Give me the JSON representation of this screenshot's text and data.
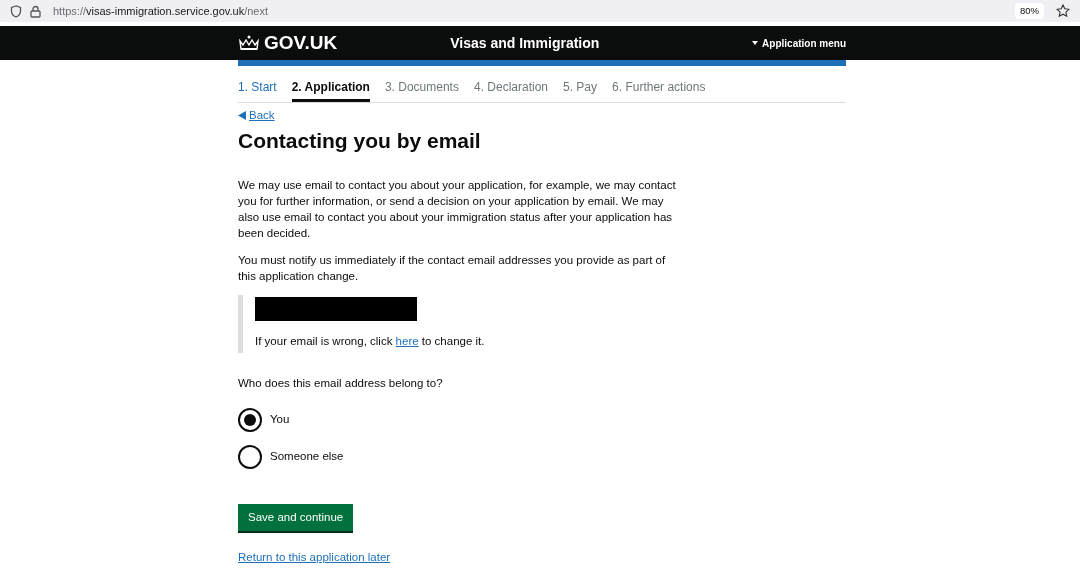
{
  "browser": {
    "url_scheme": "https://",
    "url_host": "visas-immigration.service.gov.uk",
    "url_path": "/next",
    "zoom": "80%"
  },
  "header": {
    "logo": "GOV.UK",
    "service": "Visas and Immigration",
    "menu": "Application menu"
  },
  "steps": [
    {
      "label": "1. Start",
      "completed": true,
      "selected": false
    },
    {
      "label": "2. Application",
      "completed": false,
      "selected": true
    },
    {
      "label": "3. Documents",
      "completed": false,
      "selected": false
    },
    {
      "label": "4. Declaration",
      "completed": false,
      "selected": false
    },
    {
      "label": "5. Pay",
      "completed": false,
      "selected": false
    },
    {
      "label": "6. Further actions",
      "completed": false,
      "selected": false
    }
  ],
  "back": "Back",
  "title": "Contacting you by email",
  "paragraphs": [
    "We may use email to contact you about your application, for example, we may contact you for further information, or send a decision on your application by email. We may also use email to contact you about your immigration status after your application has been decided.",
    "You must notify us immediately if the contact email addresses you provide as part of this application change."
  ],
  "inset": {
    "email_redacted": true,
    "before": "If your email is wrong, click ",
    "link": "here",
    "after": " to change it."
  },
  "question": "Who does this email address belong to?",
  "options": [
    {
      "label": "You",
      "selected": true
    },
    {
      "label": "Someone else",
      "selected": false
    }
  ],
  "submit": "Save and continue",
  "later_link": "Return to this application later"
}
